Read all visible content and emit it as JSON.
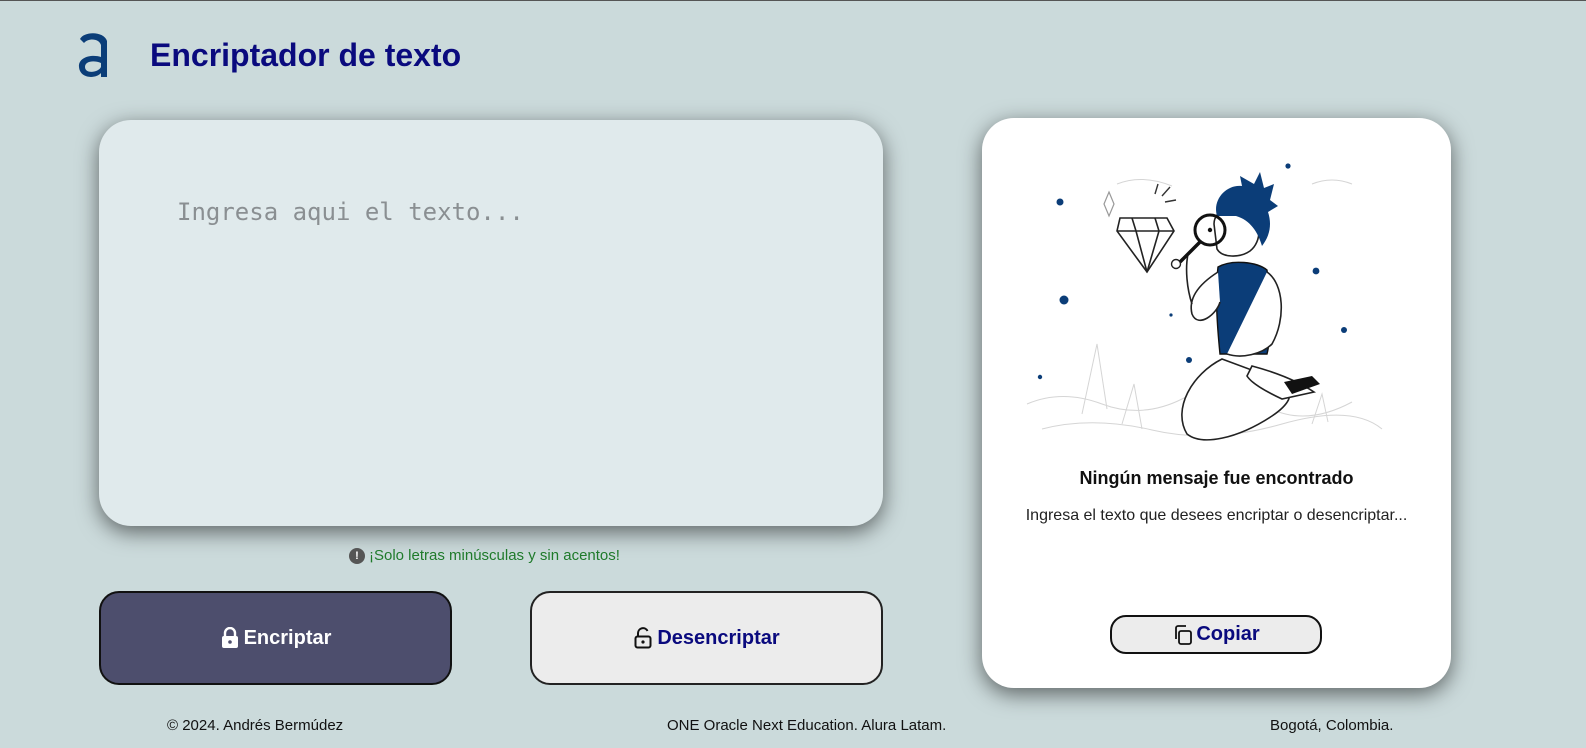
{
  "header": {
    "logo_icon": "alura-logo-icon",
    "title": "Encriptador de texto"
  },
  "input": {
    "placeholder": "Ingresa aqui el texto...",
    "value": ""
  },
  "hint": {
    "icon": "exclamation-icon",
    "text": "¡Solo letras minúsculas y sin acentos!"
  },
  "actions": {
    "encrypt_label": "Encriptar",
    "encrypt_icon": "lock-icon",
    "decrypt_label": "Desencriptar",
    "decrypt_icon": "unlock-icon"
  },
  "output": {
    "illustration": "person-with-magnifying-glass-illustration",
    "title": "Ningún mensaje fue encontrado",
    "subtitle": "Ingresa el texto que desees encriptar o desencriptar...",
    "copy_label": "Copiar",
    "copy_icon": "copy-icon"
  },
  "footer": {
    "left": "© 2024. Andrés Bermúdez",
    "center": "ONE Oracle Next Education. Alura Latam.",
    "right": "Bogotá, Colombia."
  },
  "colors": {
    "background": "#cbdadb",
    "title": "#0a0a7e",
    "encrypt_button": "#4d4e6d",
    "hint_text": "#1f7a2b",
    "illustration_accent": "#0b3d78"
  }
}
